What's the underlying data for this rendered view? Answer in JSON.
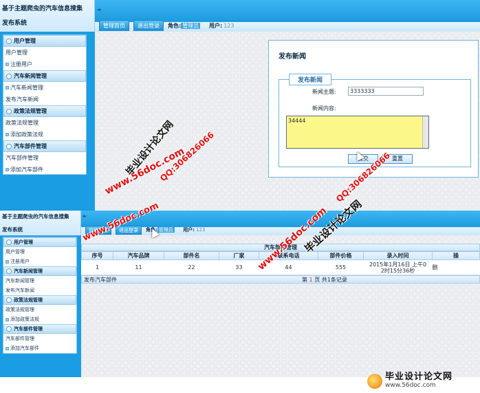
{
  "app": {
    "system_title": "基于主题爬虫的汽车信息搜集",
    "system_subtitle": "发布系统",
    "collapse_glyph": "◂▸"
  },
  "header": {
    "tabs": [
      "管理首页",
      "退出登录"
    ],
    "role_label": "角色:",
    "role_value": "管理员",
    "user_label": "用户:",
    "user_value": "123"
  },
  "sidebar": {
    "groups": [
      {
        "title": "用户管理",
        "items": [
          "用户管理",
          "注册用户"
        ]
      },
      {
        "title": "汽车新闻管理",
        "items": [
          "汽车新闻管理",
          "发布汽车新闻"
        ]
      },
      {
        "title": "政策法规管理",
        "items": [
          "政策法规管理",
          "添加政策法规"
        ]
      },
      {
        "title": "汽车部件管理",
        "items": [
          "汽车部件管理",
          "添加汽车部件"
        ]
      }
    ]
  },
  "news_form": {
    "page_title": "发布新闻",
    "legend": "发布新闻",
    "subject_label": "新闻主题:",
    "subject_value": "3333333",
    "content_label": "新闻内容:",
    "content_value": "34444",
    "submit_label": "提交",
    "reset_label": "重置"
  },
  "parts_table": {
    "caption": "汽车部件管理",
    "columns": [
      "序号",
      "汽车品牌",
      "部件名",
      "厂家",
      "联系电话",
      "部件价格",
      "录入时间",
      "操"
    ],
    "rows": [
      [
        "1",
        "11",
        "22",
        "33",
        "44",
        "555",
        "2015年1月16日 上午0\n2时15分36秒",
        "删"
      ]
    ],
    "footer_left": "发布汽车部件",
    "pager_prefix": "第",
    "pager_page": "1",
    "pager_suffix": "页",
    "pager_total": "共1条记录"
  },
  "watermarks": {
    "site_a": "www.56doc.com",
    "qq": "QQ:306826066",
    "brand": "毕业设计论文网"
  },
  "footer": {
    "brand": "毕业设计论文网",
    "url": "www.56doc.com"
  }
}
